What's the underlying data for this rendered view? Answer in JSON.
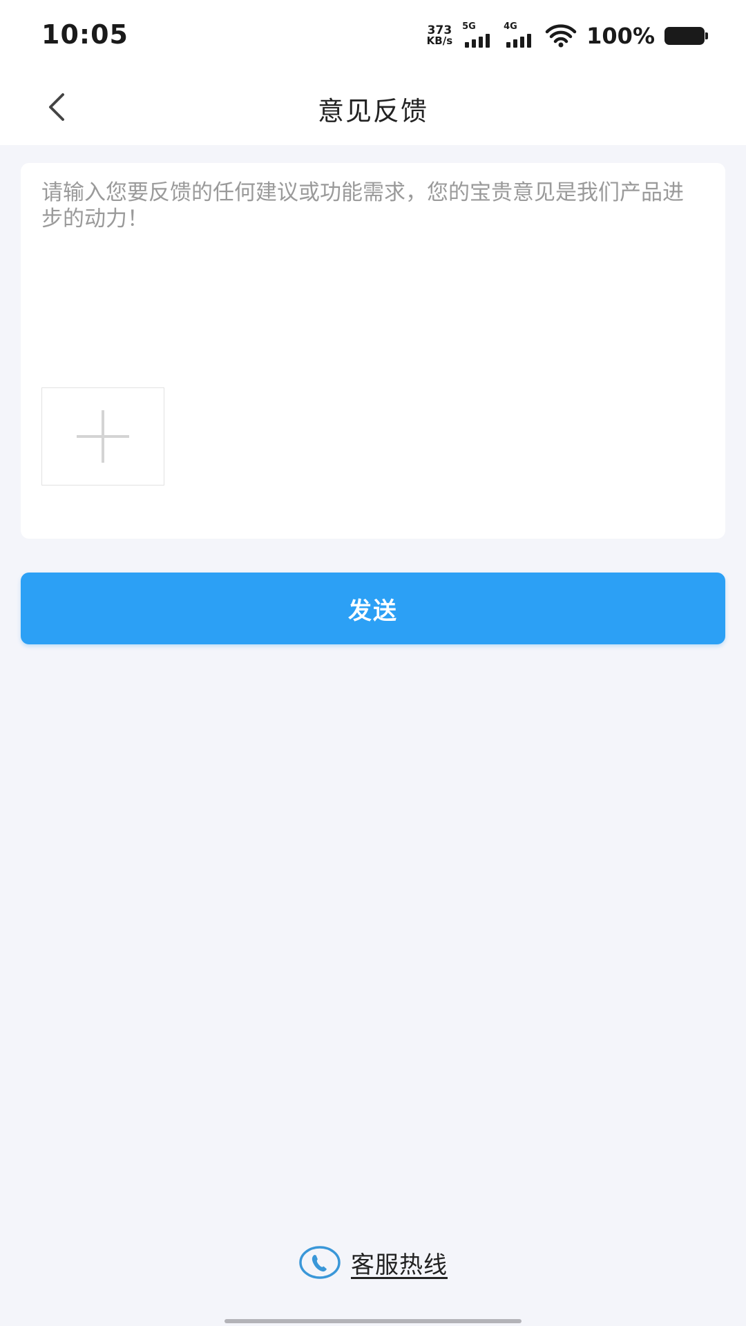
{
  "status_bar": {
    "time": "10:05",
    "net_speed_value": "373",
    "net_speed_unit": "KB/s",
    "signal_1_label": "5G",
    "signal_2_label": "4G",
    "battery_percent": "100%"
  },
  "nav": {
    "title": "意见反馈",
    "back_icon": "chevron-left-icon"
  },
  "feedback": {
    "placeholder": "请输入您要反馈的任何建议或功能需求，您的宝贵意见是我们产品进步的动力！",
    "value": "",
    "add_image_icon": "plus-icon"
  },
  "send_label": "发送",
  "hotline": {
    "label": "客服热线",
    "icon": "phone-icon"
  },
  "colors": {
    "accent": "#2ca0f5",
    "background": "#f4f5fa",
    "card": "#ffffff",
    "placeholder": "#9a9a9a"
  }
}
